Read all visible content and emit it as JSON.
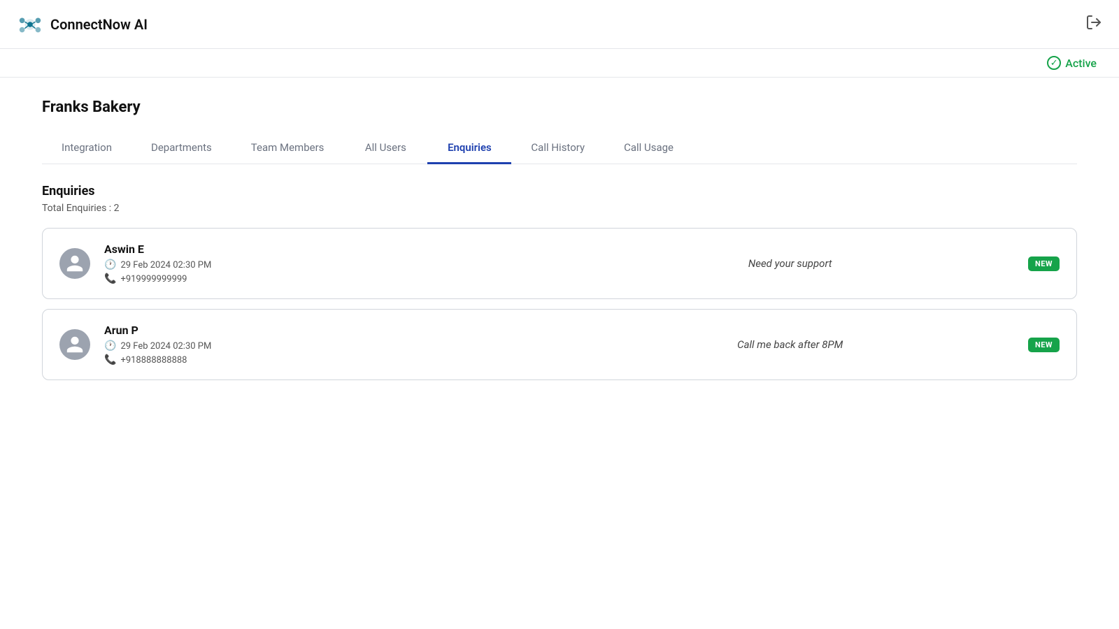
{
  "header": {
    "brand_name": "ConnectNow AI",
    "logout_label": "logout"
  },
  "status": {
    "label": "Active"
  },
  "page": {
    "title": "Franks Bakery"
  },
  "tabs": [
    {
      "id": "integration",
      "label": "Integration",
      "active": false
    },
    {
      "id": "departments",
      "label": "Departments",
      "active": false
    },
    {
      "id": "team-members",
      "label": "Team Members",
      "active": false
    },
    {
      "id": "all-users",
      "label": "All Users",
      "active": false
    },
    {
      "id": "enquiries",
      "label": "Enquiries",
      "active": true
    },
    {
      "id": "call-history",
      "label": "Call History",
      "active": false
    },
    {
      "id": "call-usage",
      "label": "Call Usage",
      "active": false
    }
  ],
  "enquiries": {
    "section_title": "Enquiries",
    "total_label": "Total Enquiries : 2",
    "items": [
      {
        "name": "Aswin E",
        "datetime": "29 Feb 2024 02:30 PM",
        "phone": "+919999999999",
        "message": "Need your support",
        "badge": "NEW"
      },
      {
        "name": "Arun P",
        "datetime": "29 Feb 2024 02:30 PM",
        "phone": "+918888888888",
        "message": "Call me back after 8PM",
        "badge": "NEW"
      }
    ]
  }
}
